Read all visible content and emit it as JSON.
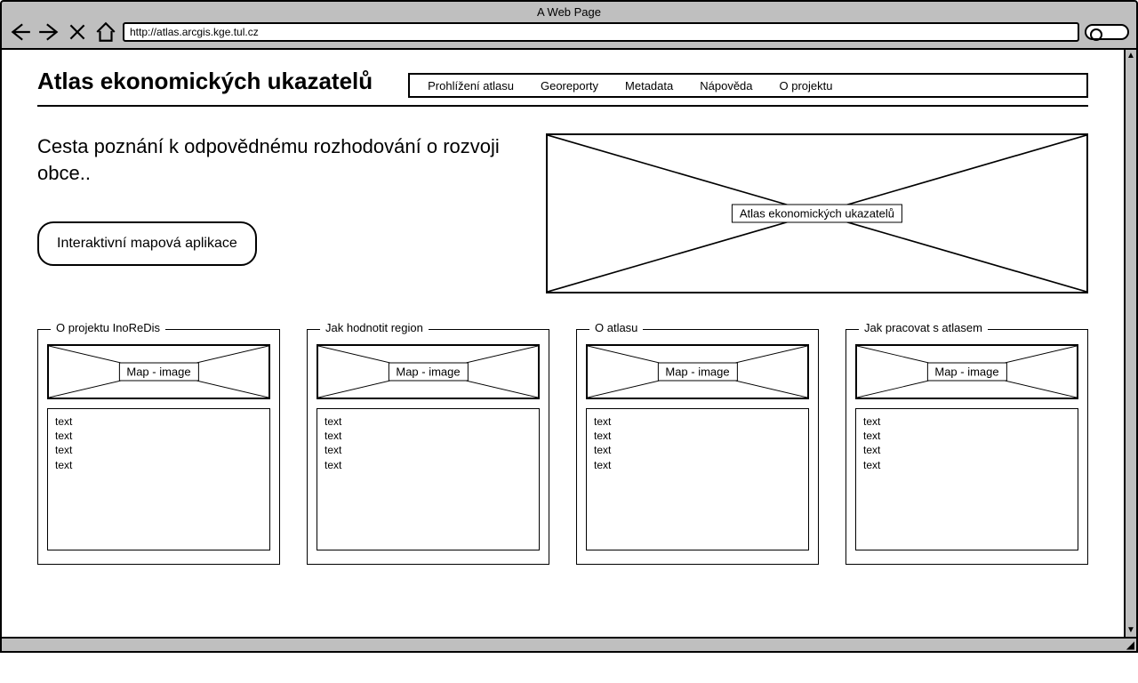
{
  "browser": {
    "title": "A Web Page",
    "url": "http://atlas.arcgis.kge.tul.cz"
  },
  "header": {
    "site_title": "Atlas ekonomických ukazatelů",
    "menu": [
      "Prohlížení atlasu",
      "Georeporty",
      "Metadata",
      "Nápověda",
      "O projektu"
    ]
  },
  "hero": {
    "tagline": "Cesta poznání k odpovědnému rozhodování o rozvoji obce..",
    "cta": "Interaktivní mapová aplikace",
    "image_placeholder": "Atlas ekonomických ukazatelů"
  },
  "cards": [
    {
      "legend": "O projektu InoReDis",
      "image": "Map - image",
      "text": "text\ntext\ntext\ntext"
    },
    {
      "legend": "Jak hodnotit region",
      "image": "Map - image",
      "text": "text\ntext\ntext\ntext"
    },
    {
      "legend": "O atlasu",
      "image": "Map - image",
      "text": "text\ntext\ntext\ntext"
    },
    {
      "legend": "Jak pracovat s atlasem",
      "image": "Map - image",
      "text": "text\ntext\ntext\ntext"
    }
  ]
}
